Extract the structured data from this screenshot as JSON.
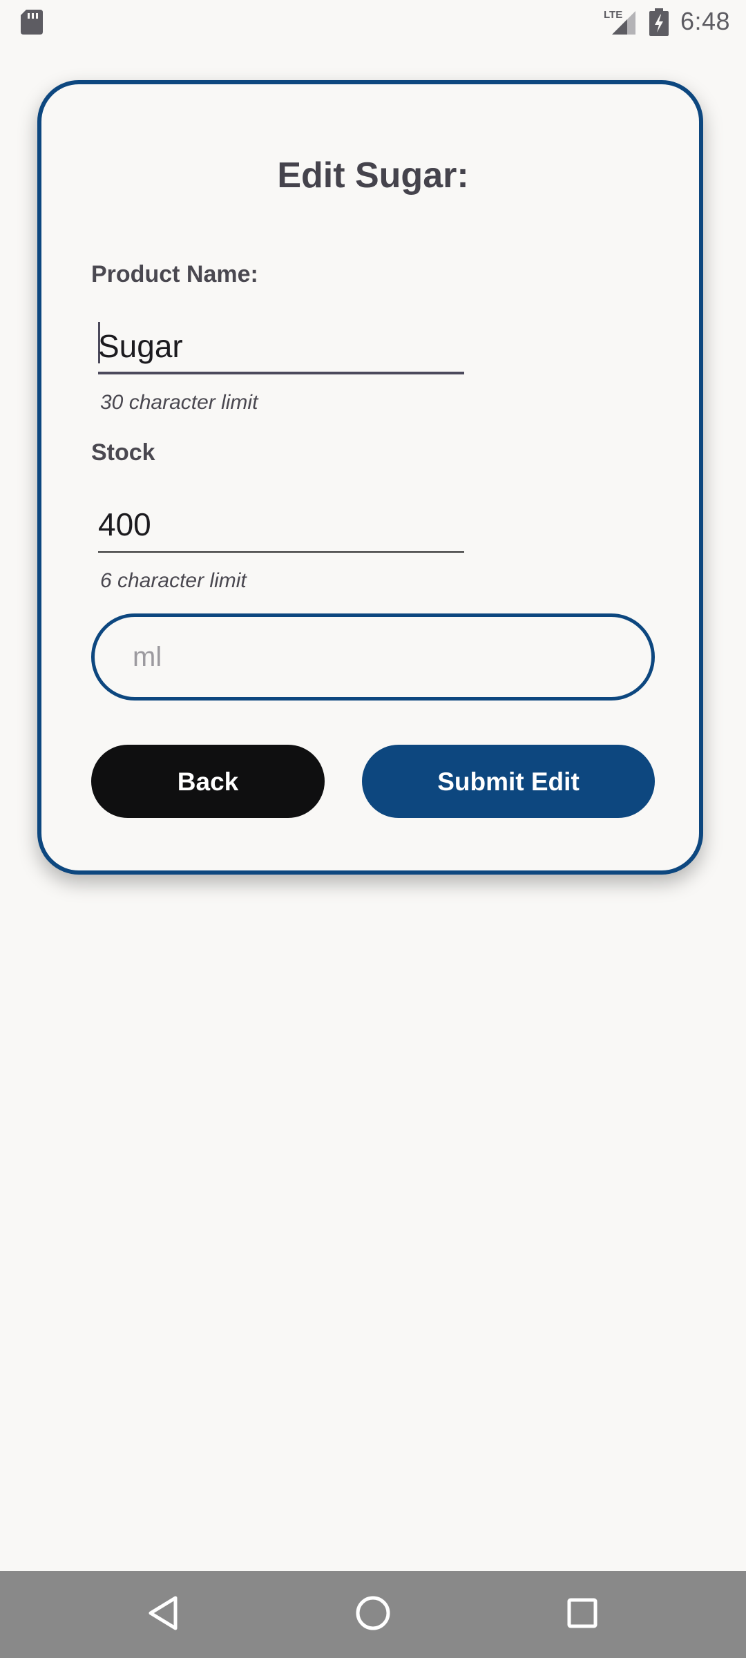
{
  "status_bar": {
    "time": "6:48",
    "network": "LTE",
    "icons": [
      "sd-card-icon",
      "lte-signal-icon",
      "battery-charging-icon"
    ]
  },
  "form": {
    "title": "Edit Sugar:",
    "product_name": {
      "label": "Product Name:",
      "value": "Sugar",
      "helper": "30 character limit"
    },
    "stock": {
      "label": "Stock",
      "value": "400",
      "helper": "6 character limit"
    },
    "unit": {
      "value": "",
      "placeholder": "ml"
    },
    "buttons": {
      "back": "Back",
      "submit": "Submit Edit"
    }
  },
  "nav_bar": {
    "icons": [
      "nav-back-icon",
      "nav-home-icon",
      "nav-recents-icon"
    ]
  },
  "colors": {
    "accent": "#0d477f",
    "background": "#f9f8f6",
    "back_button": "#0f0f10",
    "nav_bar": "#898989",
    "text": "#45434c"
  }
}
